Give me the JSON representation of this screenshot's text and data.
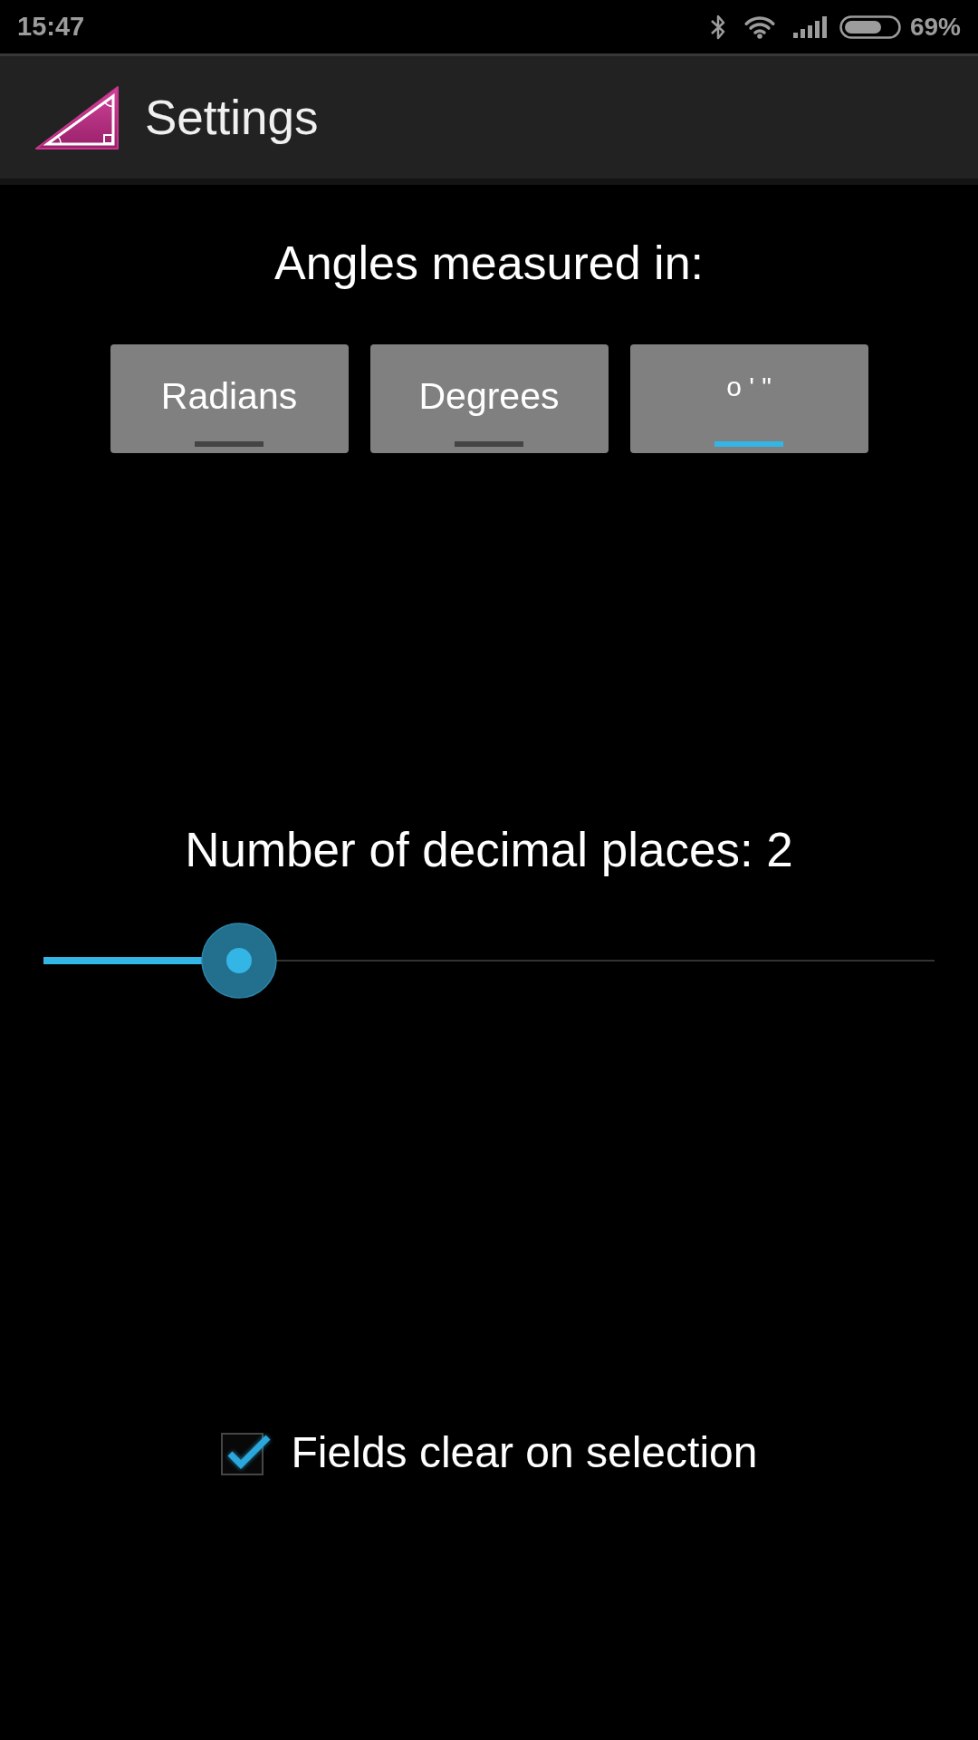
{
  "status_bar": {
    "time": "15:47",
    "battery": "69%"
  },
  "app_bar": {
    "title": "Settings"
  },
  "angle_units": {
    "heading": "Angles measured in:",
    "options": [
      {
        "label": "Radians",
        "kind": "word",
        "selected": false
      },
      {
        "label": "Degrees",
        "kind": "word",
        "selected": false
      },
      {
        "label": "o ' \"",
        "kind": "symbols",
        "selected": true
      }
    ]
  },
  "decimal_places": {
    "label": "Number of decimal places: 2",
    "level": 0.22
  },
  "settings": [
    {
      "label": "Fields clear on selection",
      "checked": true
    }
  ]
}
